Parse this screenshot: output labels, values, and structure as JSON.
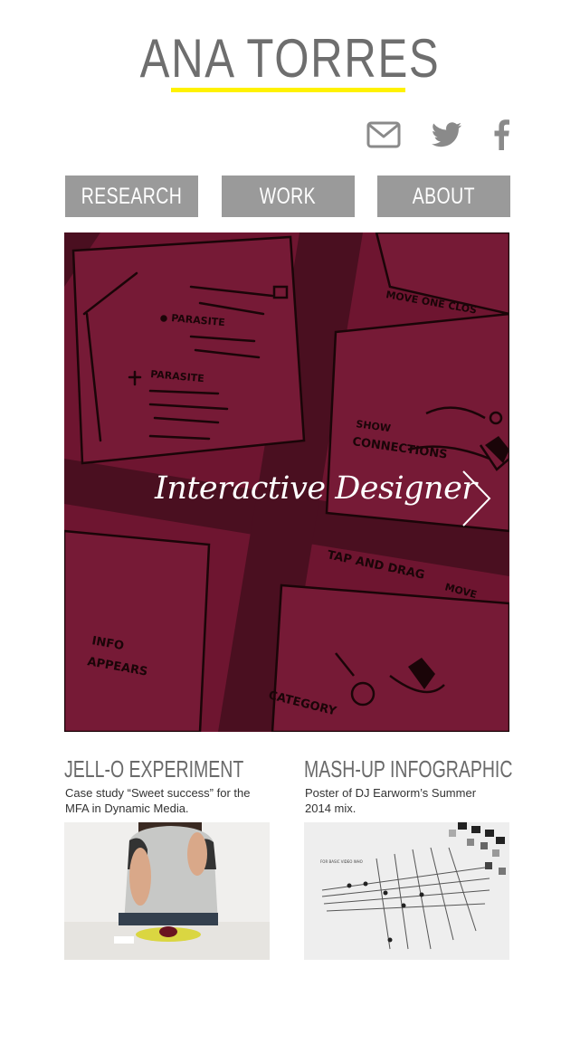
{
  "site": {
    "title": "Ana Torres",
    "accent_color": "#fff200"
  },
  "social": {
    "icons": [
      "mail-icon",
      "twitter-icon",
      "facebook-icon"
    ]
  },
  "nav": {
    "items": [
      {
        "label": "Research"
      },
      {
        "label": "Work"
      },
      {
        "label": "About"
      }
    ],
    "button_color": "#9a9a9a"
  },
  "hero": {
    "tagline": "Interactive Designer",
    "background_color": "#6e1530",
    "next_icon": "chevron-right-icon",
    "sketch_words": [
      "PARASITE",
      "PARASITE",
      "MOVE ONE",
      "CLOSE",
      "SHOW CONNECTIONS",
      "TAP AND DRAG",
      "MOVE",
      "INFO APPEARS",
      "CATEGORY"
    ]
  },
  "projects": [
    {
      "title": "Jell-o Experiment",
      "description": "Case study “Sweet success” for the MFA in Dynamic Media."
    },
    {
      "title": "Mash-up Infographic",
      "description": "Poster of DJ Earworm’s Summer 2014  mix."
    }
  ]
}
